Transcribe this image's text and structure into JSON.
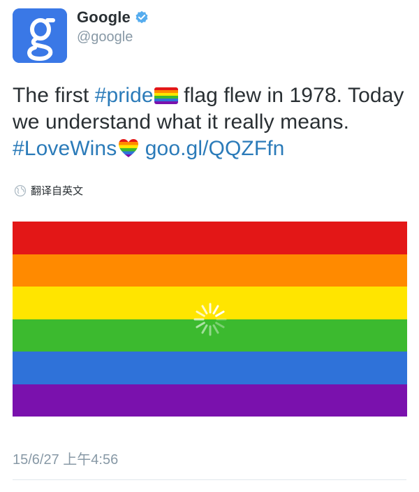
{
  "user": {
    "name": "Google",
    "handle": "@google"
  },
  "tweet": {
    "part1": "The first ",
    "hashtag_pride": "#pride",
    "part2": " flag flew in 1978. Today we understand what it really means. ",
    "hashtag_lovewins": "#LoveWins",
    "part3": " ",
    "link": "goo.gl/QQZFfn"
  },
  "translate": {
    "label": "翻译自英文"
  },
  "media": {
    "stripes": [
      "#e31717",
      "#ff8a00",
      "#ffe500",
      "#3cba2f",
      "#2f72d9",
      "#7a11ad"
    ]
  },
  "timestamp": "15/6/27 上午4:56",
  "colors": {
    "link": "#2b7bb9",
    "avatar_bg": "#3a78e6",
    "muted": "#8899a6"
  }
}
